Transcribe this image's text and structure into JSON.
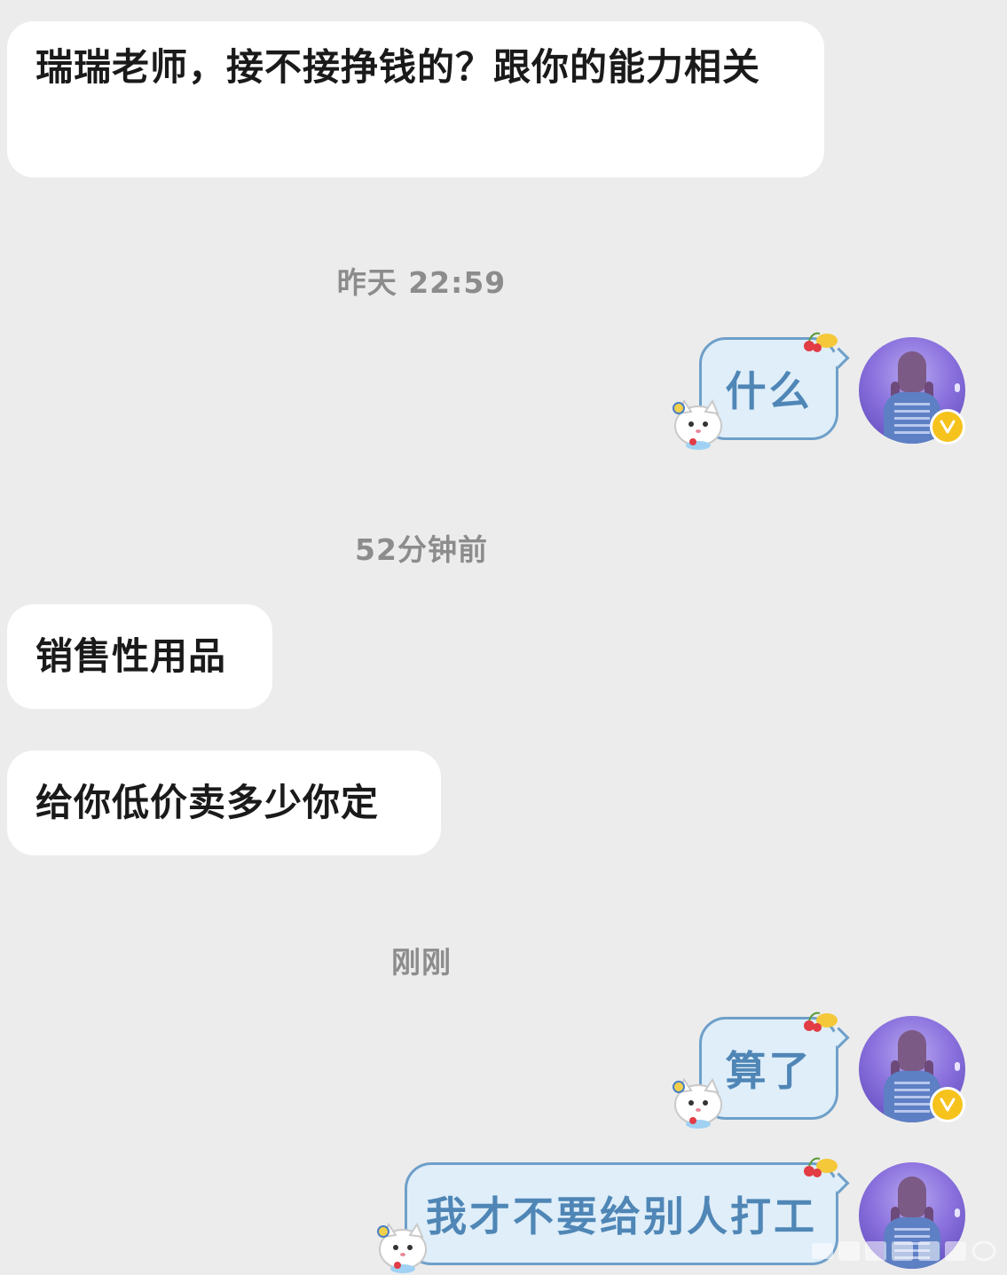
{
  "messages": {
    "m1": "瑞瑞老师，接不接挣钱的？跟你的能力相关",
    "m2": "什么",
    "m3": "销售性用品",
    "m4": "给你低价卖多少你定",
    "m5": "算了",
    "m6": "我才不要给别人打工"
  },
  "timestamps": {
    "t1": "昨天 22:59",
    "t2": "52分钟前",
    "t3": "刚刚"
  },
  "colors": {
    "background": "#ececec",
    "incoming_bubble": "#ffffff",
    "outgoing_bubble": "#dfeef9",
    "outgoing_border": "#6e9fc9",
    "outgoing_text": "#4f86b6",
    "verified_badge": "#f6c21c"
  },
  "icons": {
    "verified": "v-verified-badge-icon",
    "cat": "cat-sticker-icon",
    "fruit": "cherry-fruit-icon"
  }
}
